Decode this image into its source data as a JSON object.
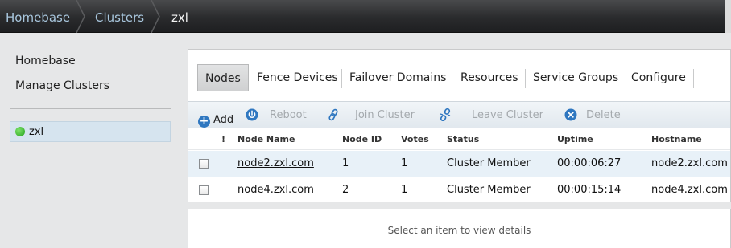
{
  "breadcrumb": {
    "items": [
      "Homebase",
      "Clusters",
      "zxl"
    ]
  },
  "sidebar": {
    "links": [
      "Homebase",
      "Manage Clusters"
    ],
    "clusters": [
      {
        "name": "zxl",
        "status_color": "#2db826"
      }
    ]
  },
  "tabs": [
    "Nodes",
    "Fence Devices",
    "Failover Domains",
    "Resources",
    "Service Groups",
    "Configure"
  ],
  "active_tab": "Nodes",
  "toolbar": {
    "add": "Add",
    "reboot": "Reboot",
    "join": "Join Cluster",
    "leave": "Leave Cluster",
    "delete": "Delete"
  },
  "table": {
    "headers": [
      "!",
      "Node Name",
      "Node ID",
      "Votes",
      "Status",
      "Uptime",
      "Hostname"
    ],
    "rows": [
      {
        "name": "node2.zxl.com",
        "id": "1",
        "votes": "1",
        "status": "Cluster Member",
        "uptime": "00:00:06:27",
        "hostname": "node2.zxl.com"
      },
      {
        "name": "node4.zxl.com",
        "id": "2",
        "votes": "1",
        "status": "Cluster Member",
        "uptime": "00:00:15:14",
        "hostname": "node4.zxl.com"
      }
    ]
  },
  "details": {
    "placeholder": "Select an item to view details"
  },
  "colors": {
    "accent": "#2f77c0",
    "selected_row": "#e8f1f8",
    "topbar": "#2a2b2d",
    "link_blue": "#a9c7de"
  }
}
